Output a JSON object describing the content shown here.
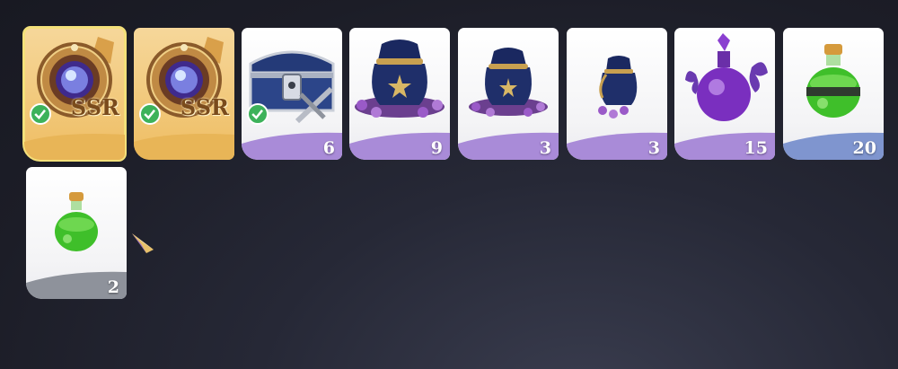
{
  "colors": {
    "band_purple": "#a98bd8",
    "band_blue": "#7f95cf",
    "band_gray": "#8e929b",
    "band_gold": "#e8b557",
    "check_green": "#3db25a",
    "selection": "#f3e07a"
  },
  "items": [
    {
      "icon": "ssr-medallion-icon",
      "badge": "SSR",
      "owned": true,
      "selected": true
    },
    {
      "icon": "ssr-medallion-icon",
      "badge": "SSR",
      "owned": true
    },
    {
      "icon": "treasure-chest-icon",
      "quantity": "6",
      "owned": true
    },
    {
      "icon": "large-coin-pouch-icon",
      "quantity": "9"
    },
    {
      "icon": "medium-coin-pouch-icon",
      "quantity": "3"
    },
    {
      "icon": "small-coin-pouch-icon",
      "quantity": "3"
    },
    {
      "icon": "purple-potion-icon",
      "quantity": "15"
    },
    {
      "icon": "green-potion-large-icon",
      "quantity": "20"
    },
    {
      "icon": "green-potion-small-icon",
      "quantity": "2"
    }
  ],
  "cursor": {
    "icon": "crystal-pointer-icon"
  }
}
